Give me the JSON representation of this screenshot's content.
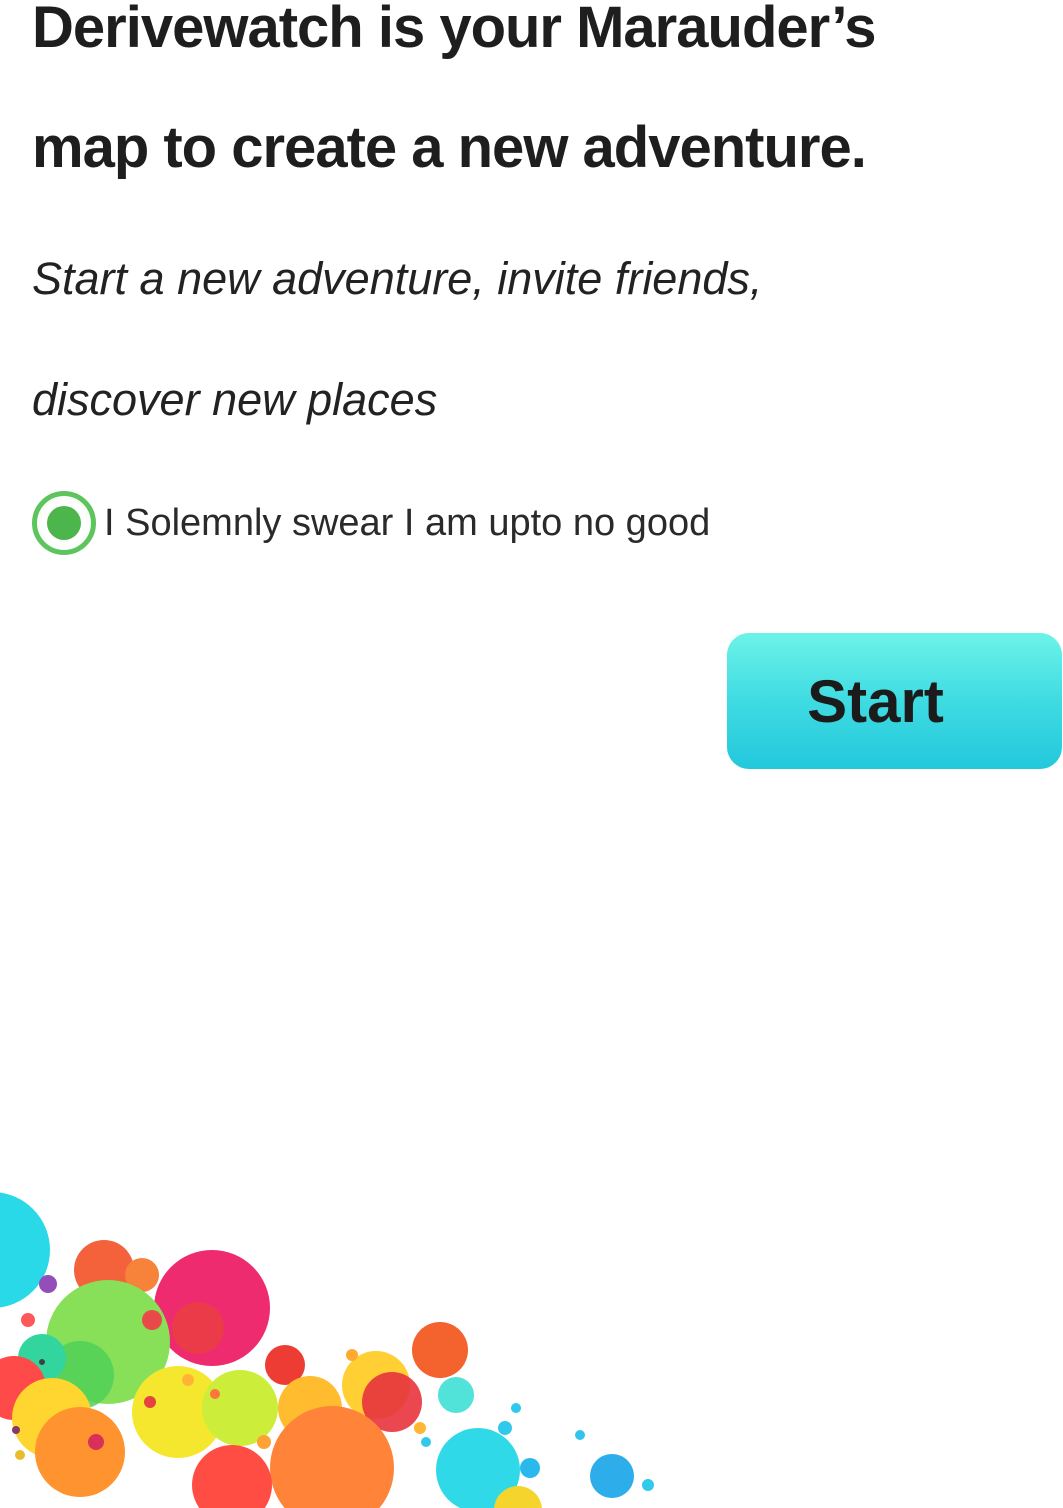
{
  "headline": {
    "line1": "Derivewatch is your Marauder’s",
    "line2": "map to create a new adventure."
  },
  "subtitle": {
    "line1": "Start a new adventure, invite friends,",
    "line2": "discover new places"
  },
  "oath": {
    "label": "I Solemnly swear I am upto no good",
    "selected": true
  },
  "start_button": {
    "label": "Start"
  },
  "colors": {
    "accent": "#3fdbe2",
    "radio": "#4cb64c"
  },
  "icons": {
    "radio": "radio-selected-icon",
    "decoration": "color-bubbles-illustration"
  }
}
